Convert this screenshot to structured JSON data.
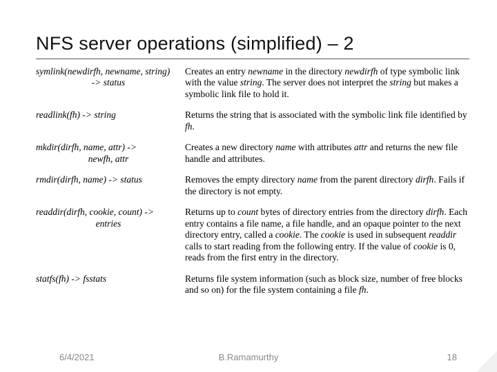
{
  "title": "NFS server operations (simplified) – 2",
  "rows": [
    {
      "sig_main": "symlink(newdirfh, newname, string)",
      "sig_cont": "-> status",
      "desc_html": "Creates an entry <em>newname</em> in the directory <em>newdirfh</em> of type symbolic link with the value <em>string</em>. The server does not interpret the <em>string</em> but makes a symbolic link file to hold it."
    },
    {
      "sig_main": "readlink(fh) -> string",
      "sig_cont": "",
      "desc_html": "Returns the string that is associated with the symbolic link file identified by <em>fh</em>."
    },
    {
      "sig_main": "mkdir(dirfh, name, attr) ->",
      "sig_cont": "newfh, attr",
      "desc_html": "Creates a new directory <em>name</em> with attributes <em>attr</em> and returns the new file handle and attributes."
    },
    {
      "sig_main": "rmdir(dirfh, name) -> status",
      "sig_cont": "",
      "desc_html": "Removes the empty directory <em>name</em> from the parent directory <em>dirfh</em>. Fails if the directory is not empty."
    },
    {
      "sig_main": "readdir(dirfh, cookie, count) ->",
      "sig_cont": "entries",
      "desc_html": "Returns up to <em>count</em> bytes of directory entries from the directory <em>dirfh</em>. Each entry contains a file name, a file handle, and an opaque pointer to the next directory entry, called a <em>cookie</em>. The <em>cookie</em> is used in subsequent <em>readdir</em> calls to start reading from the following entry. If the value of <em>cookie</em> is 0, reads from the first entry in the directory."
    },
    {
      "sig_main": "statfs(fh) -> fsstats",
      "sig_cont": "",
      "desc_html": "Returns file system information (such as block size, number of free blocks and so on) for the file system containing a file <em>fh</em>."
    }
  ],
  "footer": {
    "date": "6/4/2021",
    "author": "B.Ramamurthy",
    "page": "18"
  }
}
